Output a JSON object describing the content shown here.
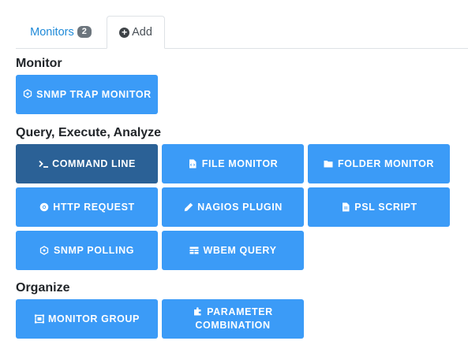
{
  "tabs": {
    "monitors": {
      "label": "Monitors",
      "count": "2"
    },
    "add": {
      "label": "Add"
    }
  },
  "sections": {
    "monitor": {
      "title": "Monitor",
      "buttons": {
        "snmp_trap": {
          "label": "SNMP TRAP MONITOR",
          "icon": "network-icon"
        }
      }
    },
    "query": {
      "title": "Query, Execute, Analyze",
      "buttons": {
        "command_line": {
          "label": "COMMAND LINE",
          "icon": "terminal-icon",
          "active": true
        },
        "file_monitor": {
          "label": "FILE MONITOR",
          "icon": "file-code-icon"
        },
        "folder_monitor": {
          "label": "FOLDER MONITOR",
          "icon": "folder-icon"
        },
        "http_request": {
          "label": "HTTP REQUEST",
          "icon": "chrome-icon"
        },
        "nagios_plugin": {
          "label": "NAGIOS PLUGIN",
          "icon": "pencil-icon"
        },
        "psl_script": {
          "label": "PSL SCRIPT",
          "icon": "file-text-icon"
        },
        "snmp_polling": {
          "label": "SNMP POLLING",
          "icon": "network-icon"
        },
        "wbem_query": {
          "label": "WBEM QUERY",
          "icon": "table-icon"
        }
      }
    },
    "organize": {
      "title": "Organize",
      "buttons": {
        "monitor_group": {
          "label": "MONITOR GROUP",
          "icon": "object-group-icon"
        },
        "parameter_combination": {
          "label": "PARAMETER COMBINATION",
          "icon": "puzzle-icon"
        }
      }
    }
  },
  "colors": {
    "button": "#3b9bf7",
    "button_active": "#2b6196",
    "tab_link": "#1f8ad8",
    "badge": "#6c757d"
  }
}
